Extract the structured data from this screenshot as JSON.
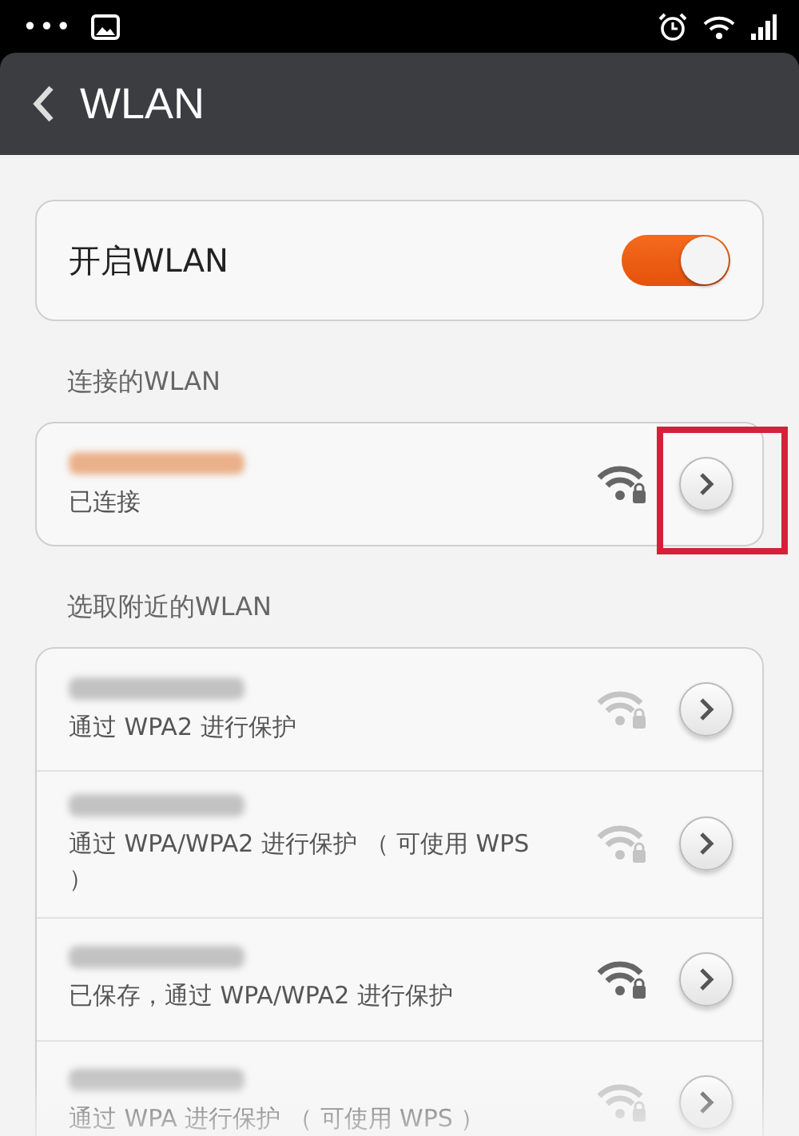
{
  "status_bar": {
    "notifications_dots": "•••"
  },
  "header": {
    "title": "WLAN"
  },
  "wlan_toggle": {
    "label": "开启WLAN",
    "on": true
  },
  "connected_section": {
    "label": "连接的WLAN",
    "networks": [
      {
        "status": "已连接",
        "strong": true,
        "highlighted": true
      }
    ]
  },
  "nearby_section": {
    "label": "选取附近的WLAN",
    "networks": [
      {
        "status": "通过 WPA2 进行保护",
        "strong": false,
        "highlighted": false
      },
      {
        "status": "通过 WPA/WPA2 进行保护 （ 可使用 WPS ）",
        "strong": false,
        "highlighted": false
      },
      {
        "status": "已保存，通过 WPA/WPA2 进行保护",
        "strong": true,
        "highlighted": false
      },
      {
        "status": "通过 WPA 进行保护 （ 可使用 WPS ）",
        "strong": false,
        "highlighted": false
      }
    ]
  }
}
